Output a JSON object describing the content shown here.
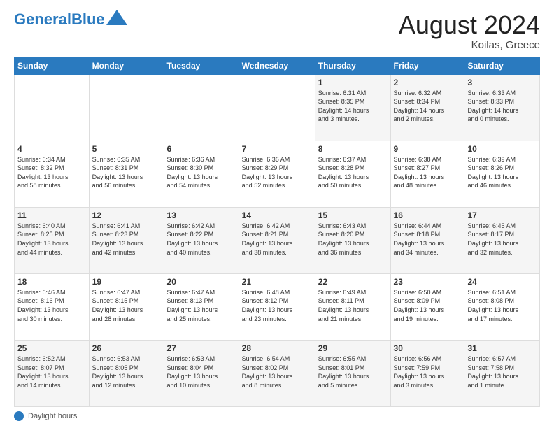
{
  "header": {
    "logo_line1": "General",
    "logo_line2": "Blue",
    "month_year": "August 2024",
    "location": "Koilas, Greece"
  },
  "footer": {
    "daylight_label": "Daylight hours"
  },
  "days_of_week": [
    "Sunday",
    "Monday",
    "Tuesday",
    "Wednesday",
    "Thursday",
    "Friday",
    "Saturday"
  ],
  "weeks": [
    [
      {
        "day": "",
        "info": ""
      },
      {
        "day": "",
        "info": ""
      },
      {
        "day": "",
        "info": ""
      },
      {
        "day": "",
        "info": ""
      },
      {
        "day": "1",
        "info": "Sunrise: 6:31 AM\nSunset: 8:35 PM\nDaylight: 14 hours\nand 3 minutes."
      },
      {
        "day": "2",
        "info": "Sunrise: 6:32 AM\nSunset: 8:34 PM\nDaylight: 14 hours\nand 2 minutes."
      },
      {
        "day": "3",
        "info": "Sunrise: 6:33 AM\nSunset: 8:33 PM\nDaylight: 14 hours\nand 0 minutes."
      }
    ],
    [
      {
        "day": "4",
        "info": "Sunrise: 6:34 AM\nSunset: 8:32 PM\nDaylight: 13 hours\nand 58 minutes."
      },
      {
        "day": "5",
        "info": "Sunrise: 6:35 AM\nSunset: 8:31 PM\nDaylight: 13 hours\nand 56 minutes."
      },
      {
        "day": "6",
        "info": "Sunrise: 6:36 AM\nSunset: 8:30 PM\nDaylight: 13 hours\nand 54 minutes."
      },
      {
        "day": "7",
        "info": "Sunrise: 6:36 AM\nSunset: 8:29 PM\nDaylight: 13 hours\nand 52 minutes."
      },
      {
        "day": "8",
        "info": "Sunrise: 6:37 AM\nSunset: 8:28 PM\nDaylight: 13 hours\nand 50 minutes."
      },
      {
        "day": "9",
        "info": "Sunrise: 6:38 AM\nSunset: 8:27 PM\nDaylight: 13 hours\nand 48 minutes."
      },
      {
        "day": "10",
        "info": "Sunrise: 6:39 AM\nSunset: 8:26 PM\nDaylight: 13 hours\nand 46 minutes."
      }
    ],
    [
      {
        "day": "11",
        "info": "Sunrise: 6:40 AM\nSunset: 8:25 PM\nDaylight: 13 hours\nand 44 minutes."
      },
      {
        "day": "12",
        "info": "Sunrise: 6:41 AM\nSunset: 8:23 PM\nDaylight: 13 hours\nand 42 minutes."
      },
      {
        "day": "13",
        "info": "Sunrise: 6:42 AM\nSunset: 8:22 PM\nDaylight: 13 hours\nand 40 minutes."
      },
      {
        "day": "14",
        "info": "Sunrise: 6:42 AM\nSunset: 8:21 PM\nDaylight: 13 hours\nand 38 minutes."
      },
      {
        "day": "15",
        "info": "Sunrise: 6:43 AM\nSunset: 8:20 PM\nDaylight: 13 hours\nand 36 minutes."
      },
      {
        "day": "16",
        "info": "Sunrise: 6:44 AM\nSunset: 8:18 PM\nDaylight: 13 hours\nand 34 minutes."
      },
      {
        "day": "17",
        "info": "Sunrise: 6:45 AM\nSunset: 8:17 PM\nDaylight: 13 hours\nand 32 minutes."
      }
    ],
    [
      {
        "day": "18",
        "info": "Sunrise: 6:46 AM\nSunset: 8:16 PM\nDaylight: 13 hours\nand 30 minutes."
      },
      {
        "day": "19",
        "info": "Sunrise: 6:47 AM\nSunset: 8:15 PM\nDaylight: 13 hours\nand 28 minutes."
      },
      {
        "day": "20",
        "info": "Sunrise: 6:47 AM\nSunset: 8:13 PM\nDaylight: 13 hours\nand 25 minutes."
      },
      {
        "day": "21",
        "info": "Sunrise: 6:48 AM\nSunset: 8:12 PM\nDaylight: 13 hours\nand 23 minutes."
      },
      {
        "day": "22",
        "info": "Sunrise: 6:49 AM\nSunset: 8:11 PM\nDaylight: 13 hours\nand 21 minutes."
      },
      {
        "day": "23",
        "info": "Sunrise: 6:50 AM\nSunset: 8:09 PM\nDaylight: 13 hours\nand 19 minutes."
      },
      {
        "day": "24",
        "info": "Sunrise: 6:51 AM\nSunset: 8:08 PM\nDaylight: 13 hours\nand 17 minutes."
      }
    ],
    [
      {
        "day": "25",
        "info": "Sunrise: 6:52 AM\nSunset: 8:07 PM\nDaylight: 13 hours\nand 14 minutes."
      },
      {
        "day": "26",
        "info": "Sunrise: 6:53 AM\nSunset: 8:05 PM\nDaylight: 13 hours\nand 12 minutes."
      },
      {
        "day": "27",
        "info": "Sunrise: 6:53 AM\nSunset: 8:04 PM\nDaylight: 13 hours\nand 10 minutes."
      },
      {
        "day": "28",
        "info": "Sunrise: 6:54 AM\nSunset: 8:02 PM\nDaylight: 13 hours\nand 8 minutes."
      },
      {
        "day": "29",
        "info": "Sunrise: 6:55 AM\nSunset: 8:01 PM\nDaylight: 13 hours\nand 5 minutes."
      },
      {
        "day": "30",
        "info": "Sunrise: 6:56 AM\nSunset: 7:59 PM\nDaylight: 13 hours\nand 3 minutes."
      },
      {
        "day": "31",
        "info": "Sunrise: 6:57 AM\nSunset: 7:58 PM\nDaylight: 13 hours\nand 1 minute."
      }
    ]
  ]
}
